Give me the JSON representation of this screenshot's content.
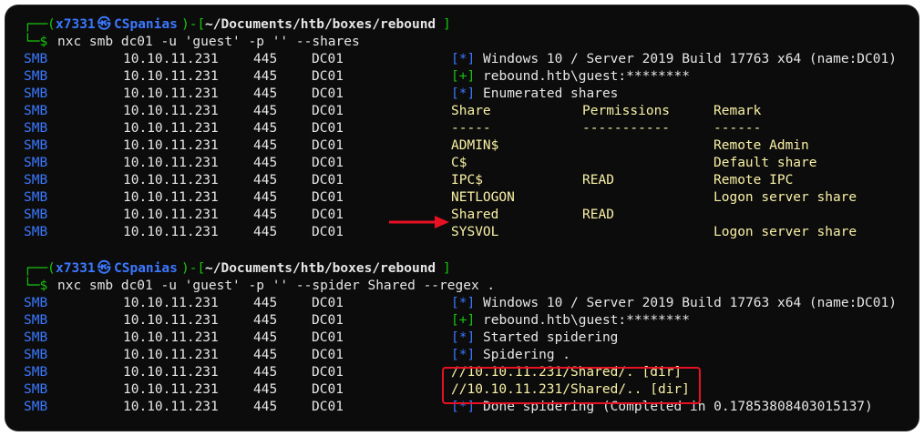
{
  "prompt1": {
    "corner": "┌──",
    "open": "(",
    "user": "x7331",
    "at": "㉿",
    "host": "CSpanias",
    ")-[": ")-[",
    "path": "~/Documents/htb/boxes/rebound",
    "close": "]",
    "prompt_symbol": "└─$",
    "command": "nxc smb dc01 -u 'guest' -p '' --shares"
  },
  "prompt2": {
    "corner": "┌──",
    "open": "(",
    "user": "x7331",
    "at": "㉿",
    "host": "CSpanias",
    ")-[": ")-[",
    "path": "~/Documents/htb/boxes/rebound",
    "close": "]",
    "prompt_symbol": "└─$",
    "command": "nxc smb dc01 -u 'guest' -p '' --spider Shared --regex ."
  },
  "block1": [
    {
      "proto": "SMB",
      "ip": "10.10.11.231",
      "port": "445",
      "name": "DC01",
      "tag": "[*]",
      "text": "Windows 10 / Server 2019 Build 17763 x64 (name:DC01)"
    },
    {
      "proto": "SMB",
      "ip": "10.10.11.231",
      "port": "445",
      "name": "DC01",
      "tag": "[+]",
      "text": "rebound.htb\\guest:********"
    },
    {
      "proto": "SMB",
      "ip": "10.10.11.231",
      "port": "445",
      "name": "DC01",
      "tag": "[*]",
      "text": "Enumerated shares"
    },
    {
      "proto": "SMB",
      "ip": "10.10.11.231",
      "port": "445",
      "name": "DC01",
      "share": "Share",
      "perm": "Permissions",
      "remark": "Remark"
    },
    {
      "proto": "SMB",
      "ip": "10.10.11.231",
      "port": "445",
      "name": "DC01",
      "share": "-----",
      "perm": "-----------",
      "remark": "------"
    },
    {
      "proto": "SMB",
      "ip": "10.10.11.231",
      "port": "445",
      "name": "DC01",
      "share": "ADMIN$",
      "perm": "",
      "remark": "Remote Admin"
    },
    {
      "proto": "SMB",
      "ip": "10.10.11.231",
      "port": "445",
      "name": "DC01",
      "share": "C$",
      "perm": "",
      "remark": "Default share"
    },
    {
      "proto": "SMB",
      "ip": "10.10.11.231",
      "port": "445",
      "name": "DC01",
      "share": "IPC$",
      "perm": "READ",
      "remark": "Remote IPC"
    },
    {
      "proto": "SMB",
      "ip": "10.10.11.231",
      "port": "445",
      "name": "DC01",
      "share": "NETLOGON",
      "perm": "",
      "remark": "Logon server share"
    },
    {
      "proto": "SMB",
      "ip": "10.10.11.231",
      "port": "445",
      "name": "DC01",
      "share": "Shared",
      "perm": "READ",
      "remark": ""
    },
    {
      "proto": "SMB",
      "ip": "10.10.11.231",
      "port": "445",
      "name": "DC01",
      "share": "SYSVOL",
      "perm": "",
      "remark": "Logon server share"
    }
  ],
  "block2": [
    {
      "proto": "SMB",
      "ip": "10.10.11.231",
      "port": "445",
      "name": "DC01",
      "tag": "[*]",
      "text": "Windows 10 / Server 2019 Build 17763 x64 (name:DC01)"
    },
    {
      "proto": "SMB",
      "ip": "10.10.11.231",
      "port": "445",
      "name": "DC01",
      "tag": "[+]",
      "text": "rebound.htb\\guest:********"
    },
    {
      "proto": "SMB",
      "ip": "10.10.11.231",
      "port": "445",
      "name": "DC01",
      "tag": "[*]",
      "text": "Started spidering"
    },
    {
      "proto": "SMB",
      "ip": "10.10.11.231",
      "port": "445",
      "name": "DC01",
      "tag": "[*]",
      "text": "Spidering ."
    },
    {
      "proto": "SMB",
      "ip": "10.10.11.231",
      "port": "445",
      "name": "DC01",
      "path": "//10.10.11.231/Shared/. [dir]"
    },
    {
      "proto": "SMB",
      "ip": "10.10.11.231",
      "port": "445",
      "name": "DC01",
      "path": "//10.10.11.231/Shared/.. [dir]"
    },
    {
      "proto": "SMB",
      "ip": "10.10.11.231",
      "port": "445",
      "name": "DC01",
      "tag": "[*]",
      "text": "Done spidering (Completed in 0.17853808403015137)"
    }
  ],
  "colors": {
    "background": "#0c0c0c",
    "prompt_green": "#16c60c",
    "smb_blue": "#3b78ff",
    "share_yellow": "#f9f1a5",
    "highlight_red": "#e81123"
  }
}
